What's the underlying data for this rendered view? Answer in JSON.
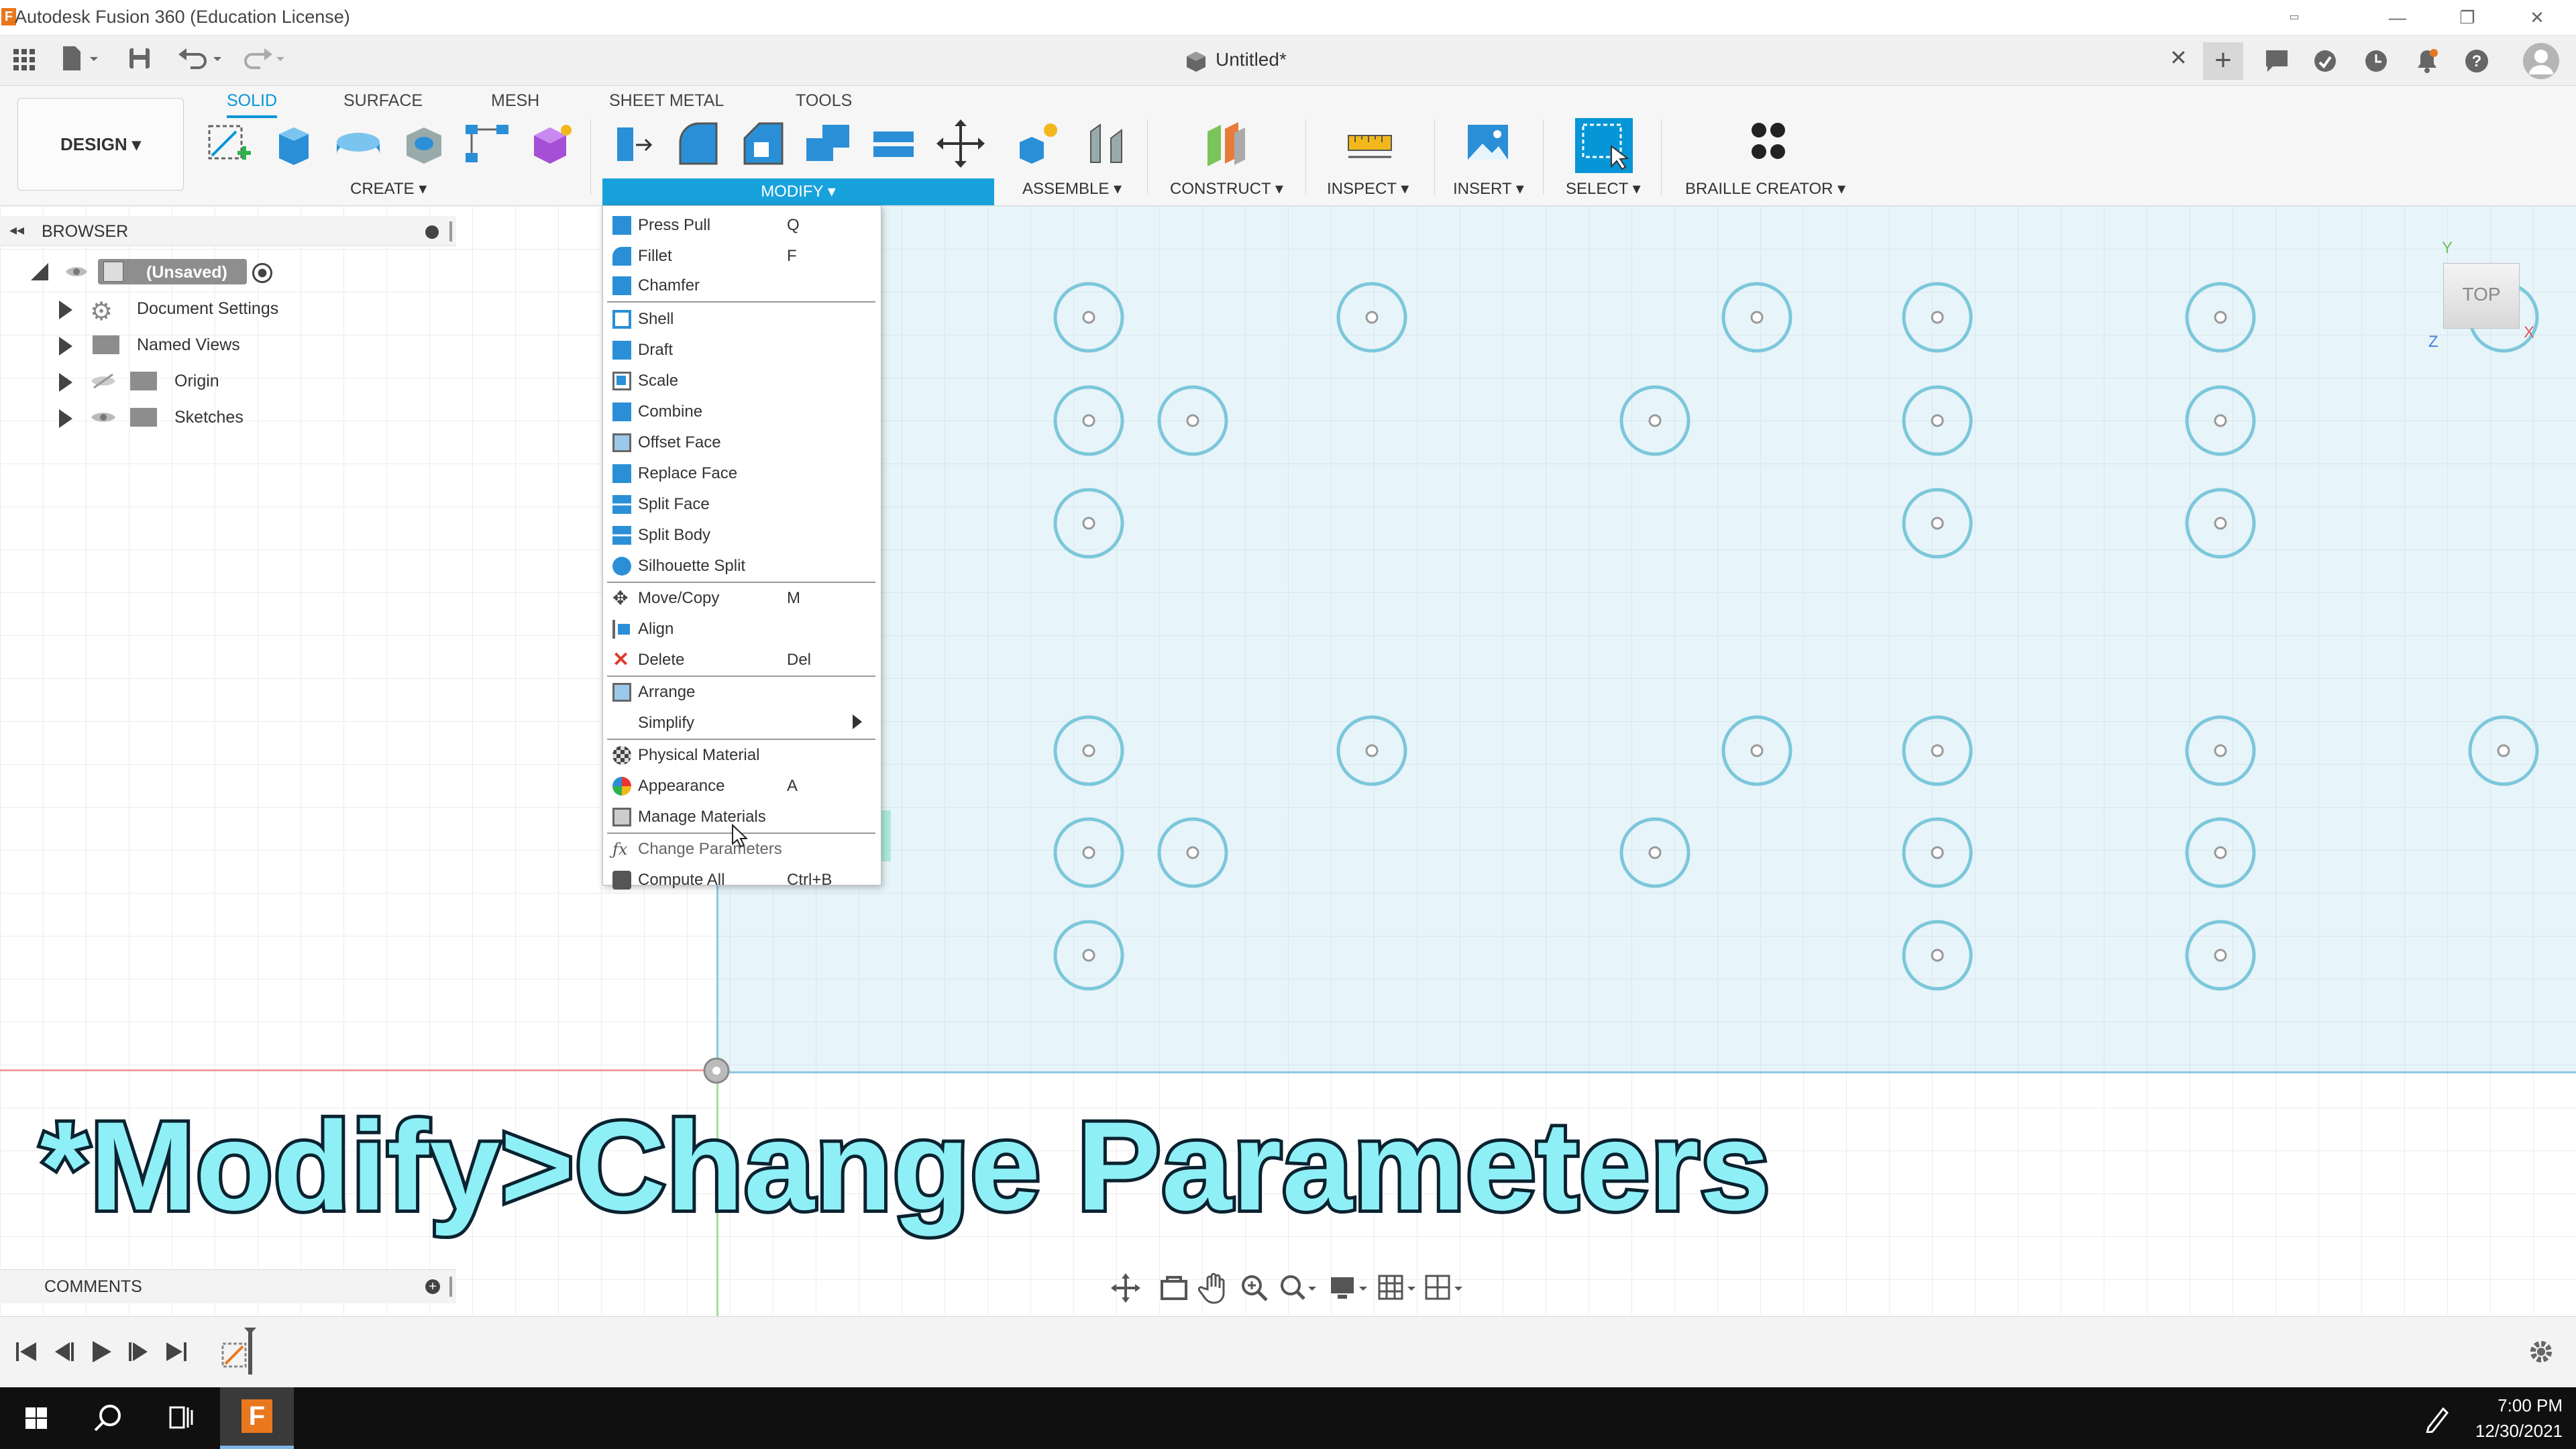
{
  "window": {
    "app_name": "Autodesk Fusion 360 (Education License)"
  },
  "app_bar": {
    "document_title": "Untitled*"
  },
  "toolbar": {
    "design_label": "DESIGN ▾",
    "tabs": [
      {
        "label": "SOLID",
        "active": true
      },
      {
        "label": "SURFACE"
      },
      {
        "label": "MESH"
      },
      {
        "label": "SHEET METAL"
      },
      {
        "label": "TOOLS"
      }
    ],
    "groups": {
      "create": "CREATE ▾",
      "modify": "MODIFY ▾",
      "assemble": "ASSEMBLE ▾",
      "construct": "CONSTRUCT ▾",
      "inspect": "INSPECT ▾",
      "insert": "INSERT ▾",
      "select": "SELECT ▾",
      "braille": "BRAILLE CREATOR ▾"
    }
  },
  "browser": {
    "title": "BROWSER",
    "root": "(Unsaved)",
    "items": [
      {
        "label": "Document Settings"
      },
      {
        "label": "Named Views"
      },
      {
        "label": "Origin"
      },
      {
        "label": "Sketches"
      }
    ]
  },
  "modify_menu": {
    "items": [
      {
        "label": "Press Pull",
        "key": "Q"
      },
      {
        "label": "Fillet",
        "key": "F"
      },
      {
        "label": "Chamfer",
        "key": ""
      },
      {
        "label": "Shell",
        "key": ""
      },
      {
        "label": "Draft",
        "key": ""
      },
      {
        "label": "Scale",
        "key": ""
      },
      {
        "label": "Combine",
        "key": ""
      },
      {
        "label": "Offset Face",
        "key": ""
      },
      {
        "label": "Replace Face",
        "key": ""
      },
      {
        "label": "Split Face",
        "key": ""
      },
      {
        "label": "Split Body",
        "key": ""
      },
      {
        "label": "Silhouette Split",
        "key": ""
      },
      {
        "label": "Move/Copy",
        "key": "M"
      },
      {
        "label": "Align",
        "key": ""
      },
      {
        "label": "Delete",
        "key": "Del"
      },
      {
        "label": "Arrange",
        "key": ""
      },
      {
        "label": "Simplify",
        "key": ""
      },
      {
        "label": "Physical Material",
        "key": ""
      },
      {
        "label": "Appearance",
        "key": "A"
      },
      {
        "label": "Manage Materials",
        "key": ""
      },
      {
        "label": "Change Parameters",
        "key": ""
      },
      {
        "label": "Compute All",
        "key": "Ctrl+B"
      }
    ]
  },
  "view_cube": {
    "label": "TOP",
    "axis_x": "X",
    "axis_y": "Y",
    "axis_z": "Z"
  },
  "overlay": {
    "caption": "*Modify>Change Parameters"
  },
  "comments": {
    "title": "COMMENTS"
  },
  "taskbar": {
    "time": "7:00 PM",
    "date": "12/30/2021"
  },
  "colors": {
    "accent": "#0696d7",
    "menu_header": "#18a2dc",
    "highlight": "#7de1c8",
    "caption_fill": "#8ef0f6",
    "caption_stroke": "#0b2230"
  }
}
